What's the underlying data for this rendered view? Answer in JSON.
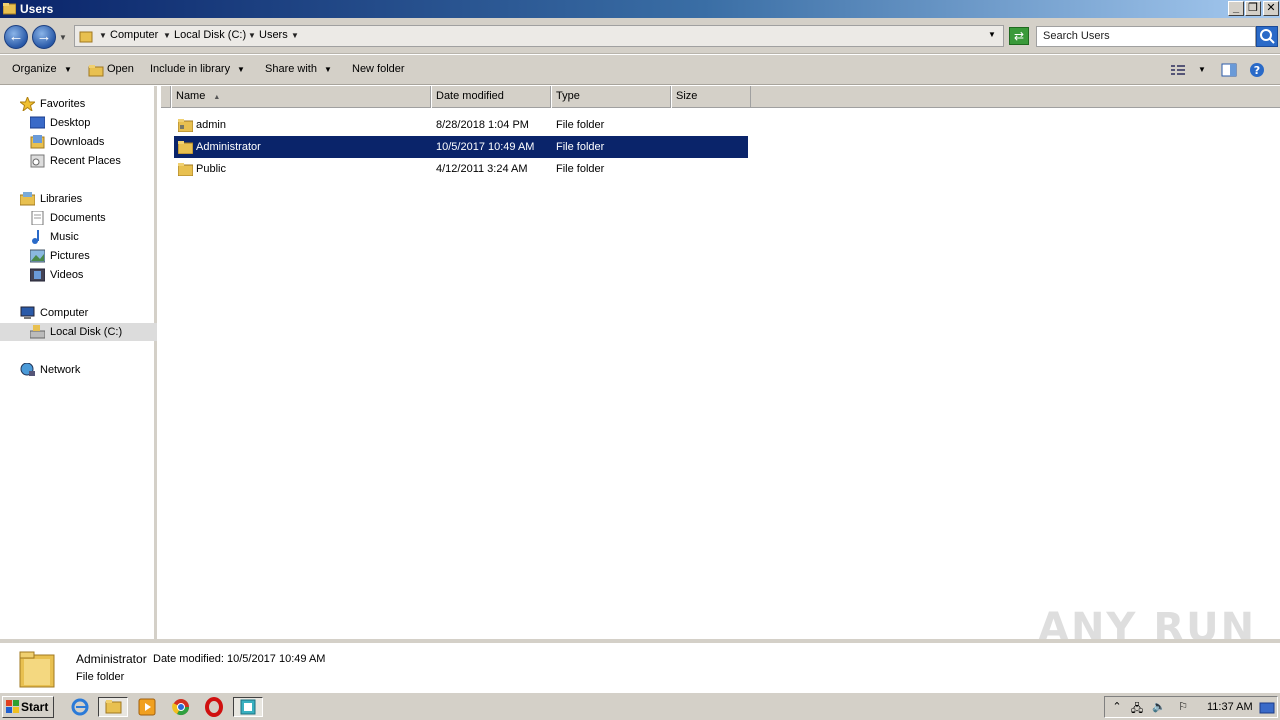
{
  "window": {
    "title": "Users"
  },
  "address": {
    "crumbs": [
      "Computer",
      "Local Disk (C:)",
      "Users"
    ],
    "search_placeholder": "Search Users"
  },
  "toolbar": {
    "organize": "Organize",
    "open": "Open",
    "include_in_library": "Include in library",
    "share_with": "Share with",
    "new_folder": "New folder"
  },
  "nav": {
    "favorites": "Favorites",
    "desktop": "Desktop",
    "downloads": "Downloads",
    "recent_places": "Recent Places",
    "libraries": "Libraries",
    "documents": "Documents",
    "music": "Music",
    "pictures": "Pictures",
    "videos": "Videos",
    "computer": "Computer",
    "local_disk": "Local Disk (C:)",
    "network": "Network"
  },
  "columns": {
    "name": "Name",
    "date_modified": "Date modified",
    "type": "Type",
    "size": "Size"
  },
  "files": [
    {
      "name": "admin",
      "date": "8/28/2018 1:04 PM",
      "type": "File folder",
      "size": ""
    },
    {
      "name": "Administrator",
      "date": "10/5/2017 10:49 AM",
      "type": "File folder",
      "size": "",
      "selected": true
    },
    {
      "name": "Public",
      "date": "4/12/2011 3:24 AM",
      "type": "File folder",
      "size": ""
    }
  ],
  "details": {
    "name": "Administrator",
    "modified_label": "Date modified: 10/5/2017 10:49 AM",
    "type": "File folder"
  },
  "watermark": "ANY RUN",
  "taskbar": {
    "start": "Start",
    "clock": "11:37 AM"
  },
  "colors": {
    "title_start": "#0a246a",
    "selection": "#0a246a",
    "chrome": "#d4d0c8"
  }
}
